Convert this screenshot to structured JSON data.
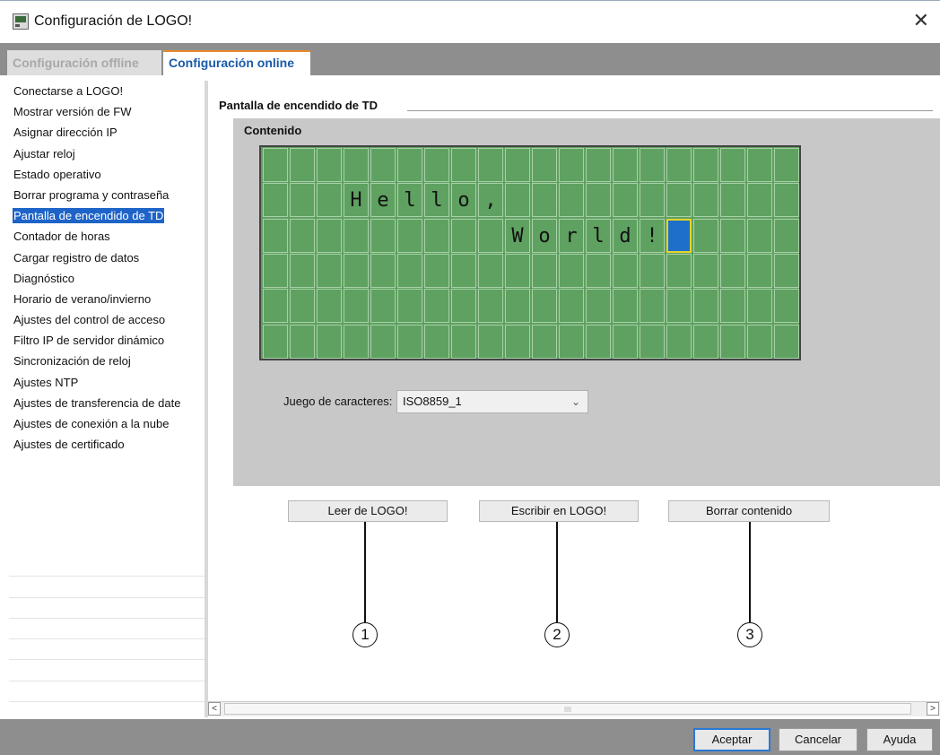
{
  "window": {
    "title": "Configuración de LOGO!",
    "close_glyph": "✕"
  },
  "tabs": [
    {
      "label": "Configuración offline",
      "active": false
    },
    {
      "label": "Configuración online",
      "active": true
    }
  ],
  "sidebar": {
    "selected_index": 6,
    "items": [
      "Conectarse a LOGO!",
      "Mostrar versión de FW",
      "Asignar dirección IP",
      "Ajustar reloj",
      "Estado operativo",
      "Borrar programa y contraseña",
      "Pantalla de encendido de TD",
      "Contador de horas",
      "Cargar registro de datos",
      "Diagnóstico",
      "Horario de verano/invierno",
      "Ajustes del control de acceso",
      "Filtro IP de servidor dinámico",
      "Sincronización de reloj",
      "Ajustes NTP",
      "Ajustes de transferencia de date",
      "Ajustes de conexión a la nube",
      "Ajustes de certificado"
    ]
  },
  "main": {
    "section_title": "Pantalla de encendido de TD",
    "content_label": "Contenido",
    "display": {
      "columns": 20,
      "rows": 6,
      "lines": [
        "",
        "   Hello,",
        "         World!",
        "",
        "",
        ""
      ],
      "cursor": {
        "row": 2,
        "col": 15
      },
      "colors": {
        "background": "#5fa161",
        "grid": "#a8d0a8",
        "cursor": "#1e6fc8",
        "cursor_border": "#e6d22a"
      }
    },
    "charset": {
      "label": "Juego de caracteres:",
      "value": "ISO8859_1"
    },
    "buttons": {
      "read": "Leer de LOGO!",
      "write": "Escribir en LOGO!",
      "clear": "Borrar contenido"
    },
    "callouts": [
      "1",
      "2",
      "3"
    ]
  },
  "scrollbar": {
    "left_arrow": "<",
    "right_arrow": ">"
  },
  "footer": {
    "accept": "Aceptar",
    "cancel": "Cancelar",
    "help": "Ayuda"
  },
  "icons": {
    "app": "logo-app-icon",
    "close": "close-icon",
    "dropdown": "chevron-down-icon"
  }
}
